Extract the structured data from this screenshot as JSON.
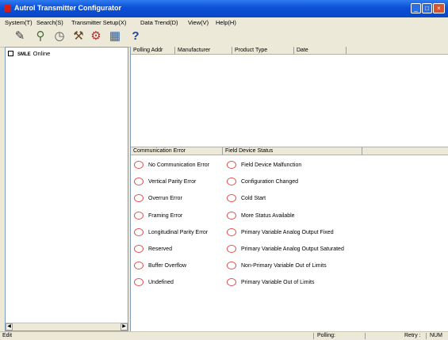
{
  "window": {
    "title": "Autrol Transmitter Configurator"
  },
  "menu": [
    "System(T)",
    "Search(S)",
    "Transmitter Setup(X)",
    "Data Trend(D)",
    "View(V)",
    "Help(H)"
  ],
  "toolbar": {
    "icons": [
      "pencil-icon",
      "probe-icon",
      "clock-icon",
      "transmitter-icon",
      "wrench-icon",
      "chart-icon",
      "query-icon"
    ]
  },
  "tree": {
    "item_badge": "SMLE",
    "item_label": "Online"
  },
  "device_list": {
    "columns": [
      "Polling Addr",
      "Manufacturer",
      "Product Type",
      "Date"
    ]
  },
  "status_panel": {
    "headers": [
      "Communication Error",
      "Field Device Status"
    ],
    "communication_errors": [
      "No Communication Error",
      "Vertical Parity Error",
      "Overrun Error",
      "Framing Error",
      "Longitudinal Parity Error",
      "Reserved",
      "Buffer Overflow",
      "Undefined"
    ],
    "field_device_status": [
      "Field Device Malfunction",
      "Configuration Changed",
      "Cold Start",
      "More Status Available",
      "Primary Variable Analog Output Fixed",
      "Primary Variable Analog Output Saturated",
      "Non-Primary Variable Out of Limits",
      "Primary Variable Out of Limits"
    ]
  },
  "statusbar": {
    "left": "Edit",
    "polling": "Polling:",
    "retry": "Retry :",
    "num": "NUM"
  },
  "colors": {
    "title_bar": "#0b4fd6",
    "status_indicator": "#e05050"
  }
}
